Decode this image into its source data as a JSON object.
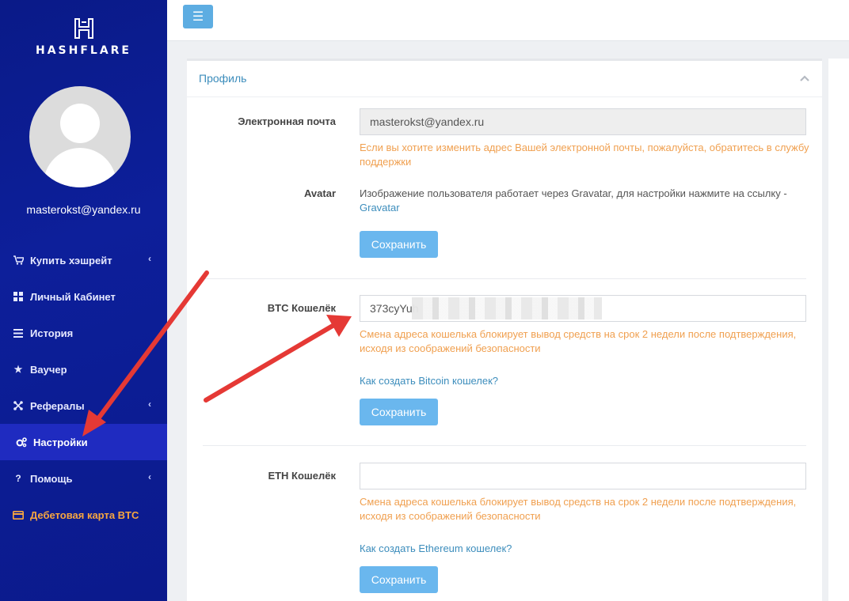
{
  "brand": {
    "name": "HASHFLARE"
  },
  "user": {
    "email": "masterokst@yandex.ru"
  },
  "sidebar": {
    "items": [
      {
        "label": "Купить хэшрейт",
        "icon": "cart-icon",
        "has_submenu": true
      },
      {
        "label": "Личный Кабинет",
        "icon": "dashboard-icon",
        "has_submenu": false
      },
      {
        "label": "История",
        "icon": "list-icon",
        "has_submenu": false
      },
      {
        "label": "Ваучер",
        "icon": "star-icon",
        "has_submenu": false
      },
      {
        "label": "Рефералы",
        "icon": "network-icon",
        "has_submenu": true
      },
      {
        "label": "Настройки",
        "icon": "gears-icon",
        "has_submenu": false,
        "active": true
      },
      {
        "label": "Помощь",
        "icon": "question-icon",
        "has_submenu": true
      },
      {
        "label": "Дебетовая карта BTC",
        "icon": "credit-card-icon",
        "has_submenu": false
      }
    ]
  },
  "panel": {
    "title": "Профиль",
    "email": {
      "label": "Электронная почта",
      "value": "masterokst@yandex.ru",
      "hint": "Если вы хотите изменить адрес Вашей электронной почты, пожалуйста, обратитесь в службу поддержки"
    },
    "avatar": {
      "label": "Avatar",
      "text": "Изображение пользователя работает через Gravatar, для настройки нажмите на ссылку -",
      "link": "Gravatar",
      "save_label": "Сохранить"
    },
    "btc": {
      "label": "BTC Кошелёк",
      "value": "373cyYuh",
      "hint": "Смена адреса кошелька блокирует вывод средств на срок 2 недели после подтверждения, исходя из соображений безопасности",
      "help_link": "Как создать Bitcoin кошелек?",
      "save_label": "Сохранить"
    },
    "eth": {
      "label": "ETH Кошелёк",
      "value": "",
      "hint": "Смена адреса кошелька блокирует вывод средств на срок 2 недели после подтверждения, исходя из соображений безопасности",
      "help_link": "Как создать Ethereum кошелек?",
      "save_label": "Сохранить"
    }
  },
  "colors": {
    "sidebar_bg": "#0d1f9a",
    "active_item": "#1f2bc0",
    "accent": "#3c8dbc",
    "button": "#6ab7ee",
    "hint": "#f0a050",
    "debit_card": "#f7a640",
    "annotation_arrow": "#e53935"
  }
}
